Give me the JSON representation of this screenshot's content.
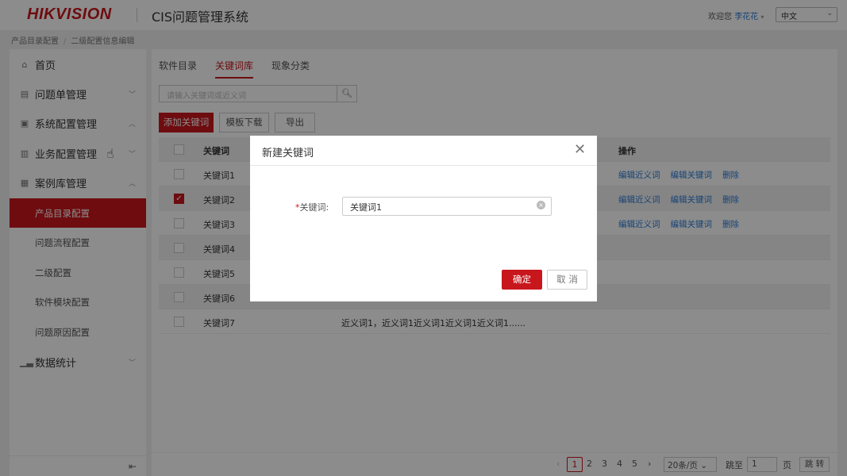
{
  "header": {
    "logo": "HIKVISION",
    "app_title": "CIS问题管理系统",
    "welcome_prefix": "欢迎您",
    "user_name": "李花花",
    "language": "中文"
  },
  "breadcrumb": [
    "产品目录配置",
    "二级配置信息编辑"
  ],
  "sidebar": {
    "items": [
      {
        "label": "首页",
        "icon": "home-icon"
      },
      {
        "label": "问题单管理",
        "icon": "document-icon"
      },
      {
        "label": "系统配置管理",
        "icon": "settings-icon"
      },
      {
        "label": "业务配置管理",
        "icon": "briefcase-icon"
      },
      {
        "label": "案例库管理",
        "icon": "archive-icon"
      }
    ],
    "sub_items": [
      "产品目录配置",
      "问题流程配置",
      "二级配置",
      "软件模块配置",
      "问题原因配置"
    ],
    "stats": {
      "label": "数据统计",
      "icon": "bar-chart-icon"
    }
  },
  "main": {
    "tabs": [
      "软件目录",
      "关键词库",
      "现象分类"
    ],
    "search_placeholder": "请输入关键词或近义词",
    "buttons": {
      "add": "添加关键词",
      "template": "模板下载",
      "export": "导出"
    },
    "table": {
      "headers": {
        "keyword": "关键词",
        "operations": "操作"
      },
      "rows": [
        {
          "keyword": "关键词1",
          "checked": false,
          "synonyms": ""
        },
        {
          "keyword": "关键词2",
          "checked": true,
          "synonyms": ""
        },
        {
          "keyword": "关键词3",
          "checked": false,
          "synonyms": ""
        },
        {
          "keyword": "关键词4",
          "checked": false,
          "synonyms": ""
        },
        {
          "keyword": "关键词5",
          "checked": false,
          "synonyms": ""
        },
        {
          "keyword": "关键词6",
          "checked": false,
          "synonyms": ""
        },
        {
          "keyword": "关键词7",
          "checked": false,
          "synonyms": "近义词1，近义词1近义词1近义词1近义词1......"
        }
      ],
      "ops": {
        "edit_synonym": "编辑近义词",
        "edit_keyword": "编辑关键词",
        "delete": "删除"
      }
    }
  },
  "pager": {
    "pages": [
      "1",
      "2",
      "3",
      "4",
      "5"
    ],
    "current": "1",
    "page_size": "20条/页",
    "jump_label": "跳至",
    "jump_value": "1",
    "page_unit": "页",
    "jump_button": "跳 转"
  },
  "modal": {
    "title": "新建关键词",
    "field_required": "*",
    "field_label": "关键词:",
    "field_value": "关键词1",
    "ok": "确定",
    "cancel": "取 消"
  },
  "colors": {
    "accent": "#c8161d",
    "link": "#2b7bd6"
  }
}
